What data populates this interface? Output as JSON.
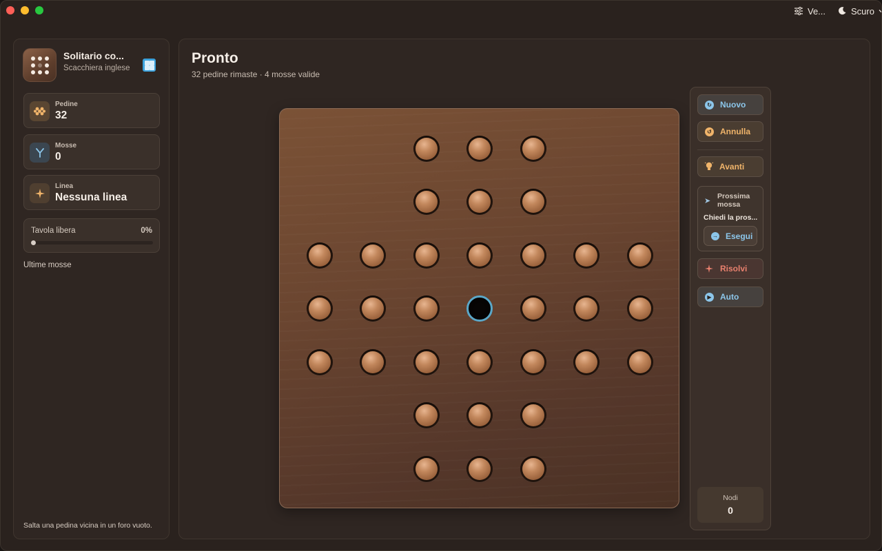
{
  "titlebar": {
    "view_label": "Ve...",
    "theme_label": "Scuro"
  },
  "sidebar": {
    "app_title": "Solitario co...",
    "app_subtitle": "Scacchiera inglese",
    "stats": [
      {
        "label": "Pedine",
        "value": "32",
        "icon": "pegs-icon"
      },
      {
        "label": "Mosse",
        "value": "0",
        "icon": "branch-icon"
      },
      {
        "label": "Linea",
        "value": "Nessuna linea",
        "icon": "sparkle-icon"
      }
    ],
    "progress": {
      "label": "Tavola libera",
      "percent_label": "0%",
      "value": 0
    },
    "recent_title": "Ultime mosse",
    "hint": "Salta una pedina vicina in un foro vuoto."
  },
  "main": {
    "title": "Pronto",
    "subtitle": "32 pedine rimaste · 4 mosse valide"
  },
  "board": {
    "type": "english",
    "rows": [
      "..xxx..",
      "..xxx..",
      "xxxxxxx",
      "xxxoxxx",
      "xxxxxxx",
      "..xxx..",
      "..xxx.."
    ],
    "empty_highlight_color": "#5aa7c8"
  },
  "controls": {
    "new_label": "Nuovo",
    "undo_label": "Annulla",
    "forward_label": "Avanti",
    "next_move_title": "Prossima mossa",
    "next_move_text": "Chiedi la pros...",
    "execute_label": "Esegui",
    "solve_label": "Risolvi",
    "auto_label": "Auto",
    "nodes_label": "Nodi",
    "nodes_value": "0"
  },
  "colors": {
    "accent_blue": "#8cc6ea",
    "accent_orange": "#f0b46a",
    "accent_red": "#e8806e"
  }
}
